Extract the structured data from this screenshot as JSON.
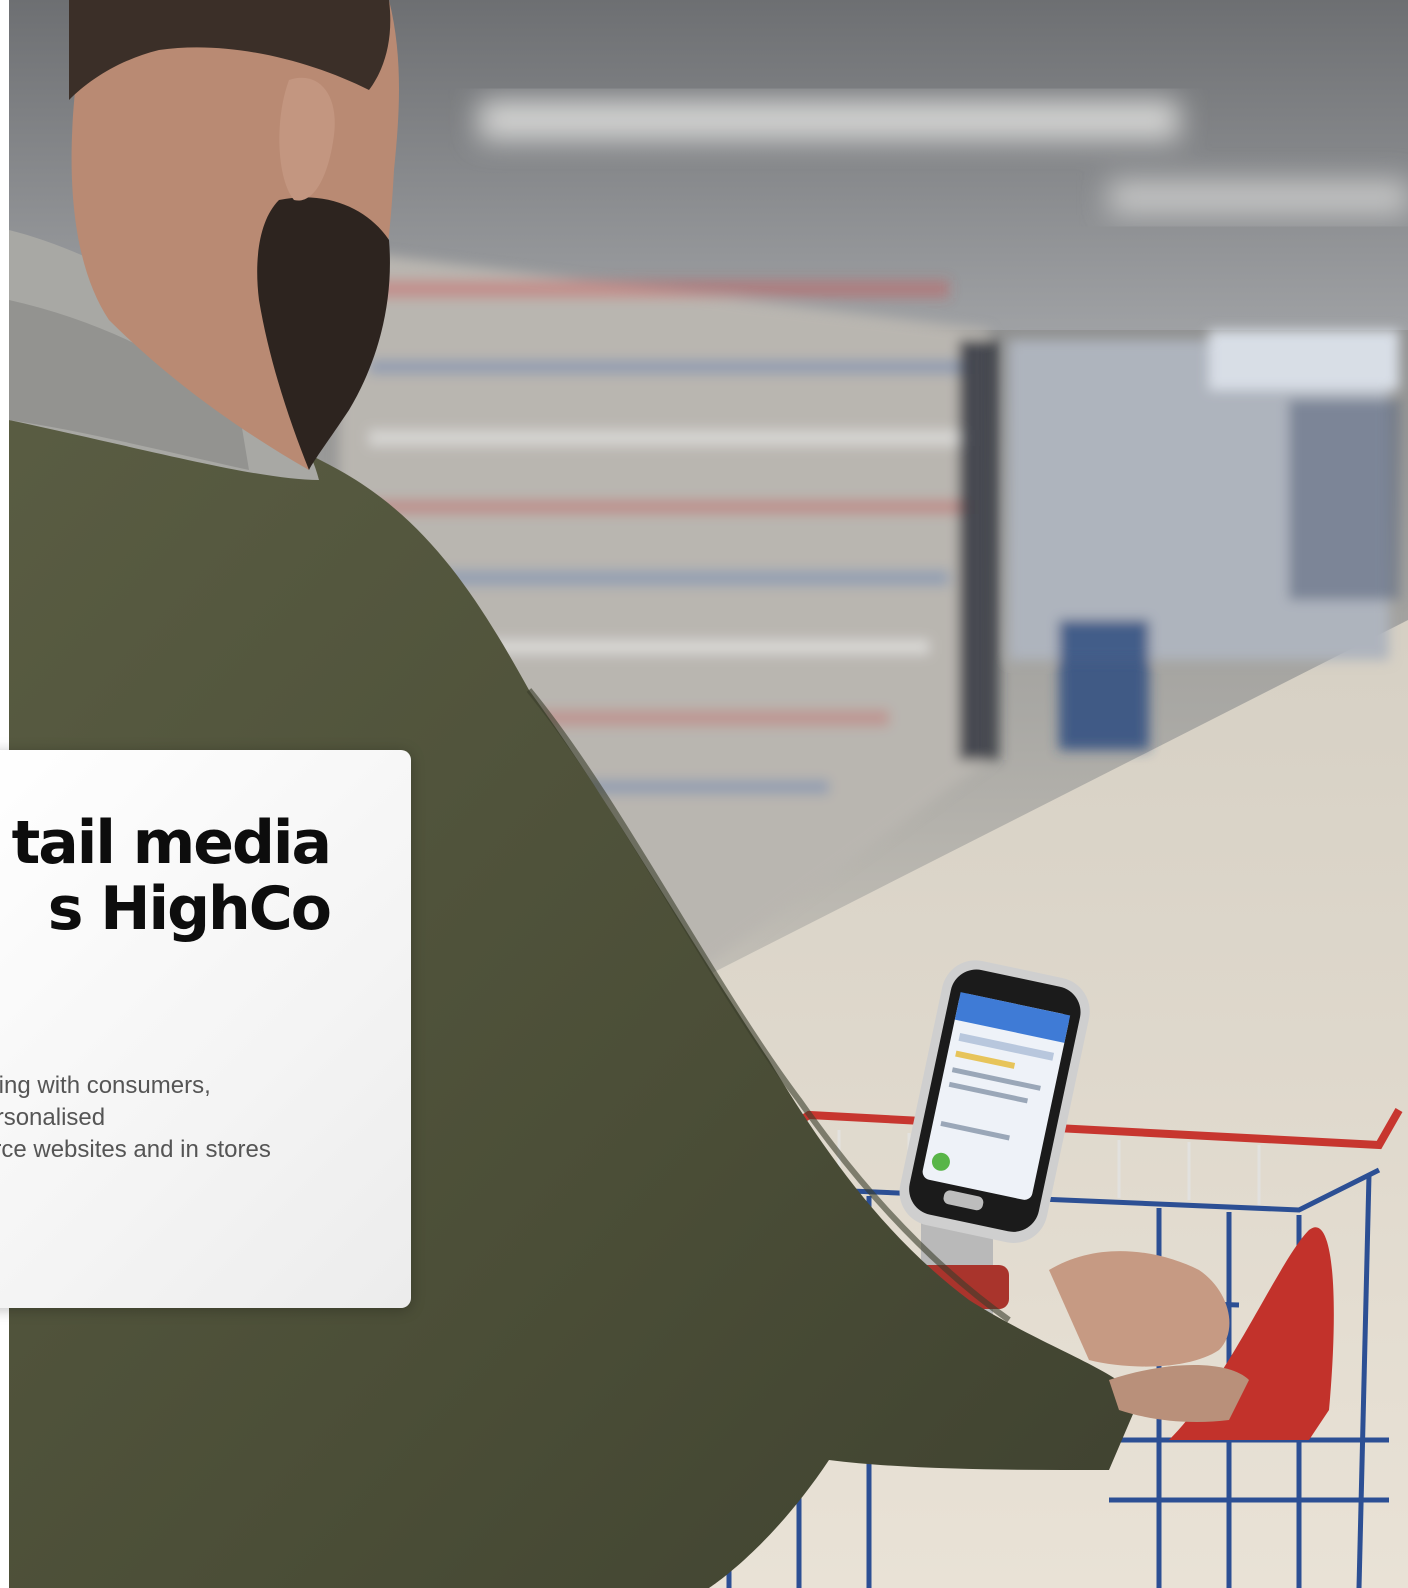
{
  "hero": {
    "description_icon": "shopper-with-cart-photo",
    "colors": {
      "jacket": "#4f5238",
      "hood": "#a6a6a3",
      "cart_frame": "#2c4f94",
      "cart_handle": "#c0322b",
      "shelf_blur": "#b9b7b2"
    }
  },
  "card": {
    "title_line_1": "tail media",
    "title_line_2": "s HighCo",
    "body_line_1": "cting with consumers,",
    "body_line_2": "personalised",
    "body_line_3": "erce websites and in stores"
  }
}
